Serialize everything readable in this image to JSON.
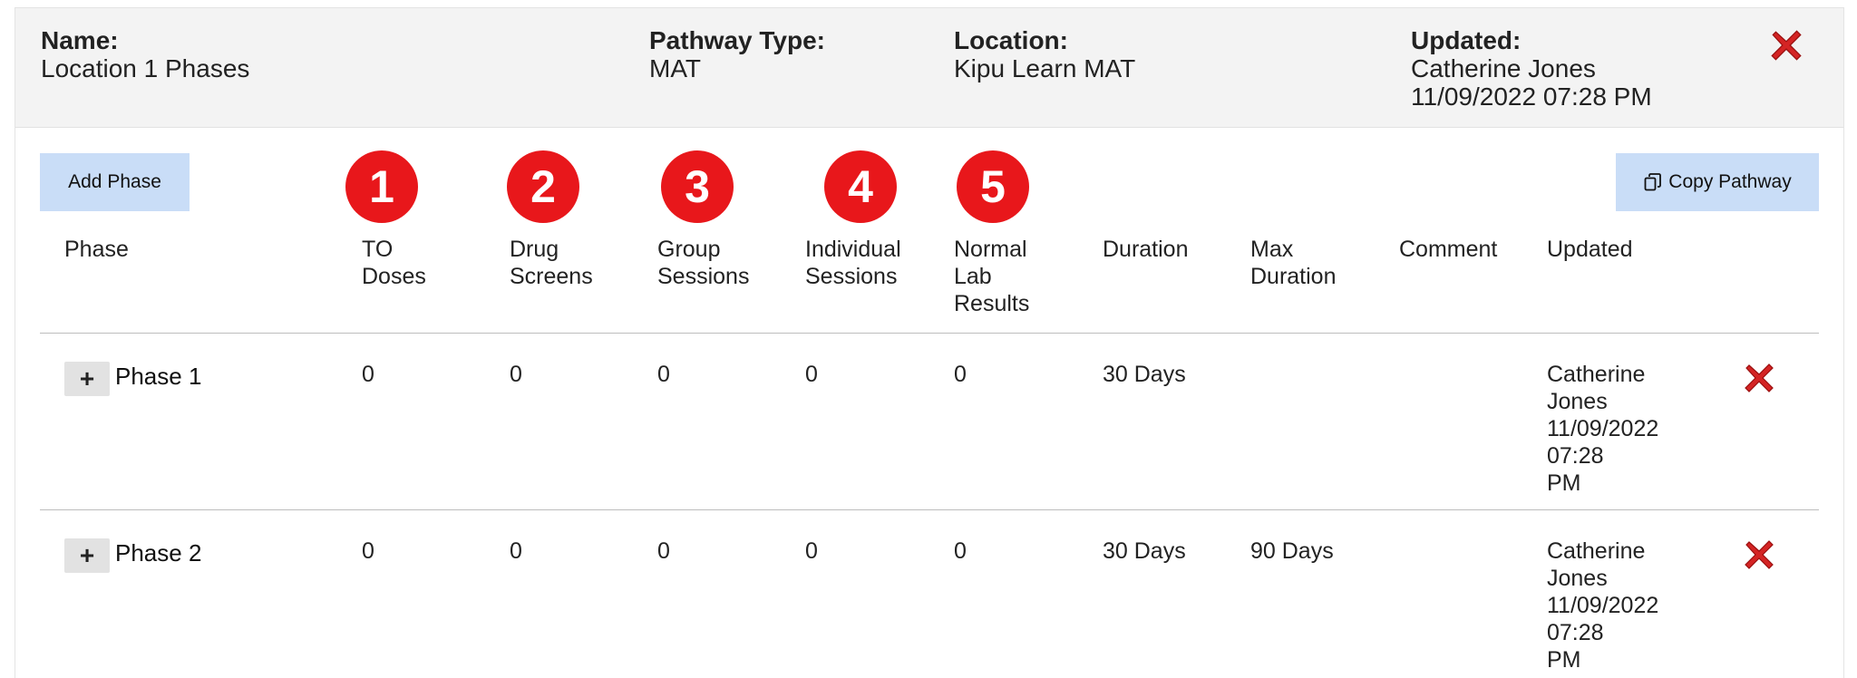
{
  "header": {
    "name_label": "Name:",
    "name_value": "Location 1 Phases",
    "pathway_type_label": "Pathway Type:",
    "pathway_type_value": "MAT",
    "location_label": "Location:",
    "location_value": "Kipu Learn MAT",
    "updated_label": "Updated:",
    "updated_by": "Catherine Jones",
    "updated_at": "11/09/2022 07:28 PM",
    "close_icon": "close-x-icon"
  },
  "toolbar": {
    "add_phase_label": "Add Phase",
    "copy_pathway_label": "Copy Pathway",
    "copy_icon": "copy-icon"
  },
  "badges": [
    "1",
    "2",
    "3",
    "4",
    "5"
  ],
  "colors": {
    "badge": "#e8171b",
    "button": "#c9ddf7",
    "delete": "#cc1f1f"
  },
  "columns": {
    "phase": "Phase",
    "to_doses": [
      "TO",
      "Doses"
    ],
    "drug_screens": [
      "Drug",
      "Screens"
    ],
    "group_sessions": [
      "Group",
      "Sessions"
    ],
    "individual_sessions": [
      "Individual",
      "Sessions"
    ],
    "normal_lab_results": [
      "Normal",
      "Lab",
      "Results"
    ],
    "duration": "Duration",
    "max_duration": [
      "Max",
      "Duration"
    ],
    "comment": "Comment",
    "updated": "Updated"
  },
  "rows": [
    {
      "expand": "+",
      "phase": "Phase 1",
      "to_doses": "0",
      "drug_screens": "0",
      "group_sessions": "0",
      "individual_sessions": "0",
      "normal_lab_results": "0",
      "duration": "30 Days",
      "max_duration": "",
      "comment": "",
      "updated": [
        "Catherine",
        "Jones",
        "11/09/2022",
        "07:28",
        "PM"
      ]
    },
    {
      "expand": "+",
      "phase": "Phase 2",
      "to_doses": "0",
      "drug_screens": "0",
      "group_sessions": "0",
      "individual_sessions": "0",
      "normal_lab_results": "0",
      "duration": "30 Days",
      "max_duration": "90 Days",
      "comment": "",
      "updated": [
        "Catherine",
        "Jones",
        "11/09/2022",
        "07:28",
        "PM"
      ]
    }
  ]
}
